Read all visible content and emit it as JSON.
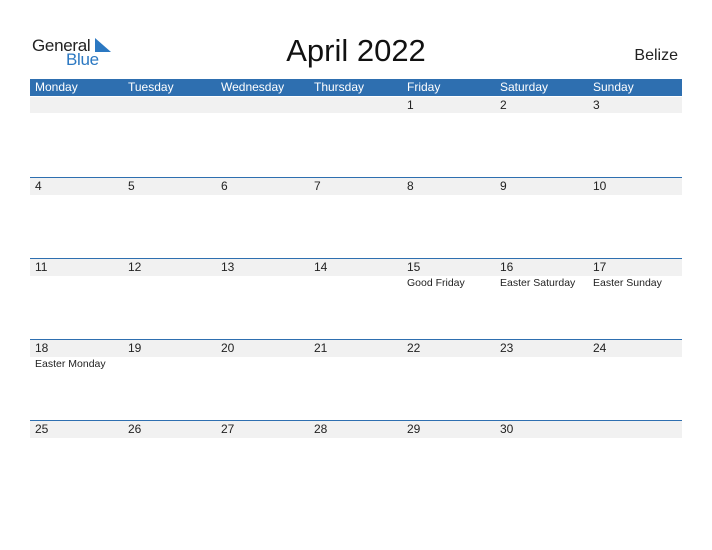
{
  "logo": {
    "line1": "General",
    "line2": "Blue",
    "accent_color": "#2b78c2"
  },
  "title": "April 2022",
  "country": "Belize",
  "colors": {
    "header_bg": "#2e6fb0",
    "row_bg": "#f1f1f1"
  },
  "weekdays": [
    "Monday",
    "Tuesday",
    "Wednesday",
    "Thursday",
    "Friday",
    "Saturday",
    "Sunday"
  ],
  "weeks": [
    [
      {
        "day": ""
      },
      {
        "day": ""
      },
      {
        "day": ""
      },
      {
        "day": ""
      },
      {
        "day": "1"
      },
      {
        "day": "2"
      },
      {
        "day": "3"
      }
    ],
    [
      {
        "day": "4"
      },
      {
        "day": "5"
      },
      {
        "day": "6"
      },
      {
        "day": "7"
      },
      {
        "day": "8"
      },
      {
        "day": "9"
      },
      {
        "day": "10"
      }
    ],
    [
      {
        "day": "11"
      },
      {
        "day": "12"
      },
      {
        "day": "13"
      },
      {
        "day": "14"
      },
      {
        "day": "15",
        "holiday": "Good Friday"
      },
      {
        "day": "16",
        "holiday": "Easter Saturday"
      },
      {
        "day": "17",
        "holiday": "Easter Sunday"
      }
    ],
    [
      {
        "day": "18",
        "holiday": "Easter Monday"
      },
      {
        "day": "19"
      },
      {
        "day": "20"
      },
      {
        "day": "21"
      },
      {
        "day": "22"
      },
      {
        "day": "23"
      },
      {
        "day": "24"
      }
    ],
    [
      {
        "day": "25"
      },
      {
        "day": "26"
      },
      {
        "day": "27"
      },
      {
        "day": "28"
      },
      {
        "day": "29"
      },
      {
        "day": "30"
      },
      {
        "day": ""
      }
    ]
  ]
}
